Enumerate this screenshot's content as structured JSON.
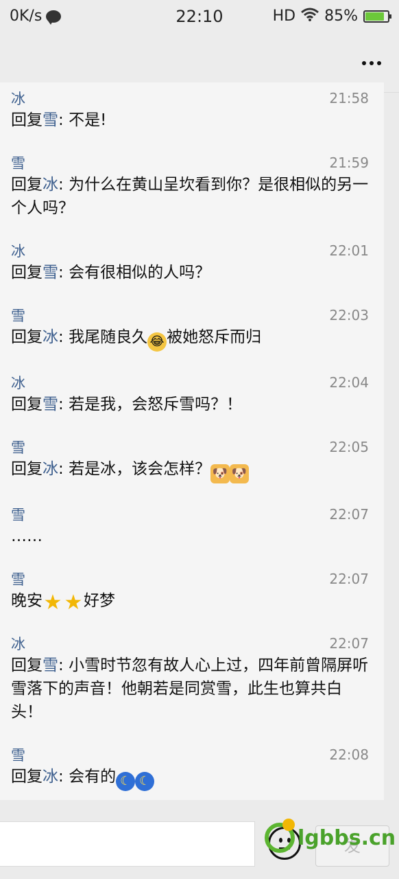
{
  "status_bar": {
    "network_speed": "0K/s",
    "time": "22:10",
    "hd": "HD",
    "battery_percent": "85%",
    "battery_level": 0.85
  },
  "comments": [
    {
      "author": "冰",
      "time": "21:58",
      "prefix": "回复",
      "target": "雪",
      "sep": ": ",
      "text": "不是!",
      "emojis": []
    },
    {
      "author": "雪",
      "time": "21:59",
      "prefix": "回复",
      "target": "冰",
      "sep": ": ",
      "text": "为什么在黄山呈坎看到你？是很相似的另一个人吗？",
      "emojis": []
    },
    {
      "author": "冰",
      "time": "22:01",
      "prefix": "回复",
      "target": "雪",
      "sep": ": ",
      "text": "会有很相似的人吗？",
      "emojis": []
    },
    {
      "author": "雪",
      "time": "22:03",
      "prefix": "回复",
      "target": "冰",
      "sep": ": ",
      "text": "我尾随良久",
      "emojis": [
        "cry-laugh-emoji"
      ],
      "text_after": "被她怒斥而归"
    },
    {
      "author": "冰",
      "time": "22:04",
      "prefix": "回复",
      "target": "雪",
      "sep": ": ",
      "text": "若是我，会怒斥雪吗？！",
      "emojis": []
    },
    {
      "author": "雪",
      "time": "22:05",
      "prefix": "回复",
      "target": "冰",
      "sep": ": ",
      "text": "若是冰，该会怎样？",
      "emojis": [
        "doge-emoji",
        "doge-emoji"
      ]
    },
    {
      "author": "雪",
      "time": "22:07",
      "prefix": "",
      "target": "",
      "sep": "",
      "text": "……",
      "emojis": []
    },
    {
      "author": "雪",
      "time": "22:07",
      "prefix": "",
      "target": "",
      "sep": "",
      "text": "晚安",
      "emojis": [
        "star-emoji",
        "star-emoji"
      ],
      "text_after": "好梦"
    },
    {
      "author": "冰",
      "time": "22:07",
      "prefix": "回复",
      "target": "雪",
      "sep": ": ",
      "text": "小雪时节忽有故人心上过，四年前曾隔屏听雪落下的声音！他朝若是同赏雪，此生也算共白头！",
      "emojis": []
    },
    {
      "author": "雪",
      "time": "22:08",
      "prefix": "回复",
      "target": "冰",
      "sep": ": ",
      "text": "会有的",
      "emojis": [
        "moon-emoji",
        "moon-emoji"
      ]
    }
  ],
  "input_bar": {
    "placeholder": "",
    "send_label": "发"
  },
  "watermark": {
    "text": "lgbbs.cn"
  },
  "colors": {
    "name_blue": "#3d5f8e",
    "battery_green": "#6cc83a"
  }
}
